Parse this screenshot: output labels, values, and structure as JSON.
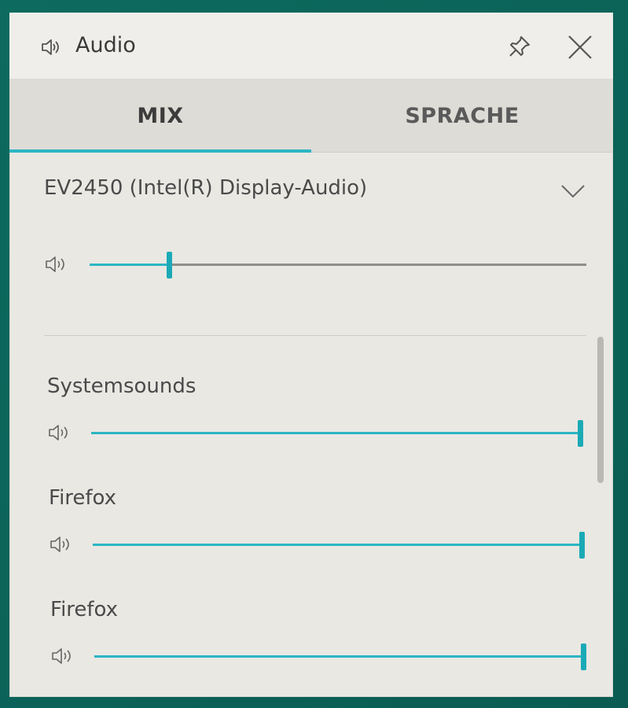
{
  "window": {
    "title": "Audio",
    "title_icon": "speaker-icon",
    "pin_icon": "pin-icon",
    "close_icon": "close-icon"
  },
  "tabs": [
    {
      "label": "MIX",
      "active": true
    },
    {
      "label": "SPRACHE",
      "active": false
    }
  ],
  "device": {
    "name": "EV2450 (Intel(R) Display-Audio)",
    "dropdown_icon": "chevron-down-icon",
    "volume_fraction": 0.16
  },
  "apps": [
    {
      "name": "Systemsounds",
      "volume_fraction": 1.0
    },
    {
      "name": "Firefox",
      "volume_fraction": 1.0
    },
    {
      "name": "Firefox",
      "volume_fraction": 1.0
    }
  ],
  "colors": {
    "accent": "#2bb6c3",
    "panel_background": "#e9e8e3",
    "frame": "#0f6b5f"
  }
}
